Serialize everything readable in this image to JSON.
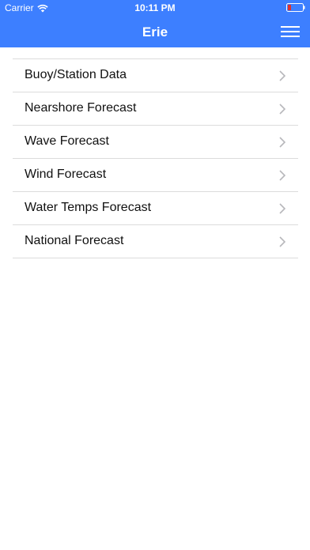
{
  "status_bar": {
    "carrier": "Carrier",
    "time": "10:11 PM",
    "battery_color": "#e0302c"
  },
  "nav": {
    "title": "Erie",
    "background": "#3d7fff"
  },
  "menu": {
    "items": [
      {
        "label": "Buoy/Station Data"
      },
      {
        "label": "Nearshore Forecast"
      },
      {
        "label": "Wave Forecast"
      },
      {
        "label": "Wind Forecast"
      },
      {
        "label": "Water Temps Forecast"
      },
      {
        "label": "National Forecast"
      }
    ]
  }
}
